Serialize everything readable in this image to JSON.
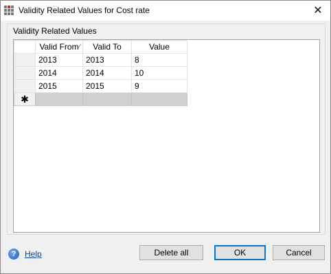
{
  "window": {
    "title": "Validity Related Values for Cost rate"
  },
  "group": {
    "label": "Validity Related Values"
  },
  "grid": {
    "columns": [
      "Valid From",
      "Valid To",
      "Value"
    ],
    "rows": [
      [
        "2013",
        "2013",
        "8"
      ],
      [
        "2014",
        "2014",
        "10"
      ],
      [
        "2015",
        "2015",
        "9"
      ]
    ],
    "new_row_marker": "✱"
  },
  "footer": {
    "help_label": "Help",
    "delete_all_label": "Delete all",
    "ok_label": "OK",
    "cancel_label": "Cancel"
  },
  "icons": {
    "app": "grid-app-icon",
    "close": "close-icon",
    "help": "help-icon",
    "sort": "sort-indicator-icon"
  },
  "colors": {
    "accent": "#0078d7",
    "link": "#0645ad"
  }
}
